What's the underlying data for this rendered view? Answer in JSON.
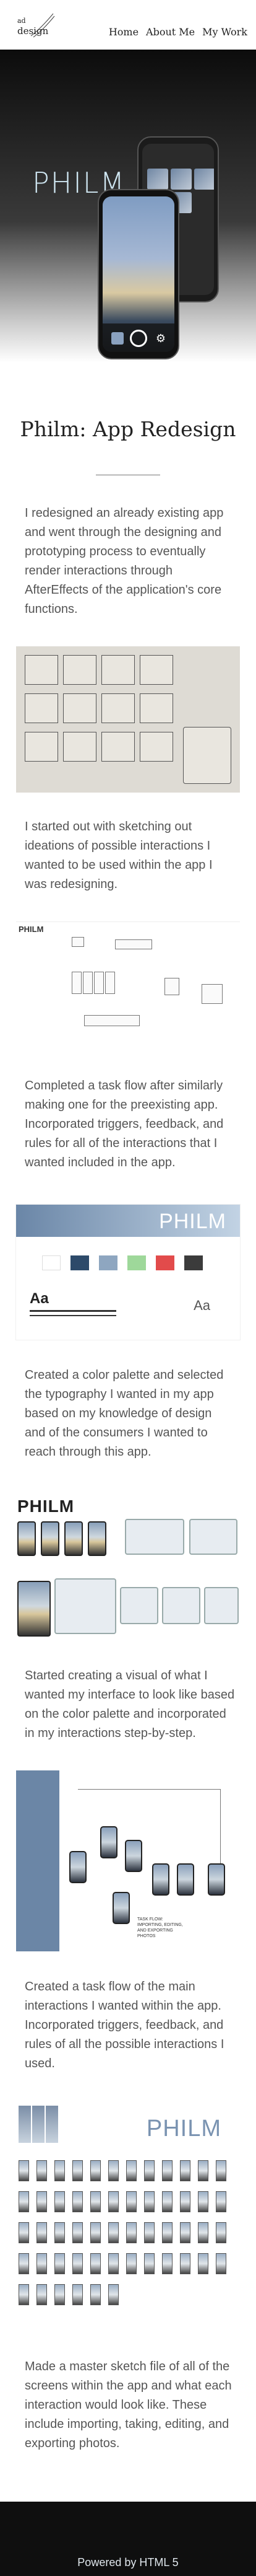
{
  "header": {
    "logo": {
      "top": "ad",
      "bottom": "design"
    },
    "nav": [
      "Home",
      "About Me",
      "My Work"
    ]
  },
  "hero": {
    "title": "PHILM"
  },
  "project": {
    "title": "Philm: App Redesign",
    "intro": "I redesigned an already existing app and went through the designing and prototyping process to eventually render interactions through AfterEffects of the application's core functions.",
    "sections": [
      {
        "caption": "I started out with sketching out ideations of possible interactions I wanted to be used within the app I was redesigning."
      },
      {
        "caption": "Completed a task flow after similarly making one for the preexisting app. Incorporated triggers, feedback, and rules for all of the interactions that I wanted included in the app."
      },
      {
        "caption": "Created a color palette and selected the typography I wanted in my app based on my knowledge of design and of the consumers I wanted to reach through this app."
      },
      {
        "caption": "Started creating a visual of what I wanted my interface to look like based on the color palette and incorporated in my interactions step-by-step."
      },
      {
        "caption": "Created a task flow of the main interactions I wanted within the app. Incorporated triggers, feedback, and rules of all the possible interactions I used."
      },
      {
        "caption": "Made a master sketch file of all of the screens within the app and what each interaction would look like. These include importing, taking, editing, and exporting photos."
      }
    ]
  },
  "taskflow": {
    "title": "PHILM"
  },
  "palette": {
    "brand": "PHILM",
    "type_sample": "Aa",
    "colors": [
      "#ffffff",
      "#2d4a6a",
      "#8ea6c0",
      "#9ed89a",
      "#e24b4b",
      "#3b3b3b"
    ]
  },
  "visuals": {
    "title": "PHILM"
  },
  "iflow": {
    "note": "TASK FLOW: IMPORTING, EDITING, AND EXPORTING PHOTOS"
  },
  "master": {
    "title": "PHILM"
  },
  "footer": {
    "text": "Powered by HTML 5"
  }
}
